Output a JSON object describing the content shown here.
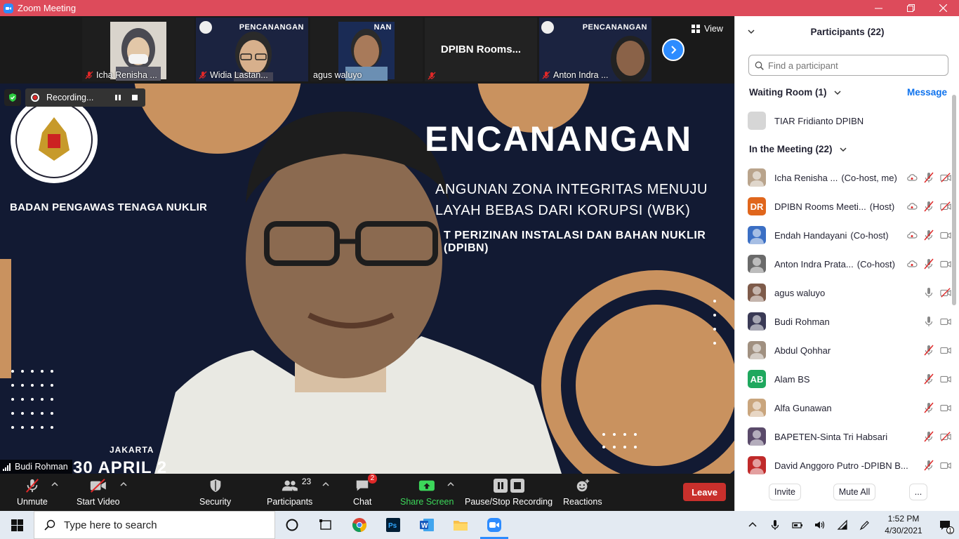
{
  "window": {
    "title": "Zoom Meeting"
  },
  "thumbnails": [
    {
      "name": "Icha Renisha ...",
      "muted": true
    },
    {
      "name": "Widia Lastan...",
      "muted": true,
      "slide_text": "PENCANANGAN"
    },
    {
      "name": "agus waluyo",
      "muted": false,
      "slide_text": "NAN"
    },
    {
      "name": "DPIBN Rooms...",
      "muted": true,
      "text_only": true
    },
    {
      "name": "Anton Indra ...",
      "muted": true,
      "slide_text": "PENCANANGAN"
    }
  ],
  "view_label": "View",
  "recording": {
    "label": "Recording..."
  },
  "main_video": {
    "speaker": "Budi Rohman",
    "slide": {
      "org": "BADAN PENGAWAS TENAGA NUKLIR",
      "title": "ENCANANGAN",
      "line1": "ANGUNAN ZONA INTEGRITAS MENUJU",
      "line2": "LAYAH BEBAS DARI KORUPSI (WBK)",
      "line3": "T PERIZINAN INSTALASI DAN BAHAN NUKLIR (DPIBN)",
      "city": "JAKARTA",
      "date": "30 APRIL 2"
    }
  },
  "toolbar": {
    "unmute": "Unmute",
    "start_video": "Start Video",
    "security": "Security",
    "participants": "Participants",
    "participants_count": "23",
    "chat": "Chat",
    "chat_badge": "2",
    "share_screen": "Share Screen",
    "recording": "Pause/Stop Recording",
    "reactions": "Reactions",
    "leave": "Leave"
  },
  "panel": {
    "title": "Participants (22)",
    "search_placeholder": "Find a participant",
    "waiting_room": "Waiting Room (1)",
    "message": "Message",
    "waiting": [
      {
        "name": "TIAR Fridianto DPIBN"
      }
    ],
    "in_meeting": "In the Meeting (22)",
    "participants": [
      {
        "name": "Icha Renisha ...",
        "role": "(Co-host, me)",
        "avatar": "photo",
        "color": "#b9a48c",
        "rec": true,
        "mic": "muted",
        "cam": "off"
      },
      {
        "name": "DPIBN Rooms Meeti...",
        "role": "(Host)",
        "avatar": "DR",
        "color": "#e0661c",
        "rec": true,
        "mic": "muted",
        "cam": "off"
      },
      {
        "name": "Endah Handayani",
        "role": "(Co-host)",
        "avatar": "photo",
        "color": "#3b6fc4",
        "rec": true,
        "mic": "muted",
        "cam": "on"
      },
      {
        "name": "Anton Indra Prata...",
        "role": "(Co-host)",
        "avatar": "photo",
        "color": "#6a6a6a",
        "rec": true,
        "mic": "muted",
        "cam": "on"
      },
      {
        "name": "agus waluyo",
        "role": "",
        "avatar": "photo",
        "color": "#7e5b4a",
        "rec": false,
        "mic": "on",
        "cam": "off"
      },
      {
        "name": "Budi Rohman",
        "role": "",
        "avatar": "photo",
        "color": "#3a3a55",
        "rec": false,
        "mic": "on",
        "cam": "on"
      },
      {
        "name": "Abdul Qohhar",
        "role": "",
        "avatar": "photo",
        "color": "#a09080",
        "rec": false,
        "mic": "muted",
        "cam": "on"
      },
      {
        "name": "Alam BS",
        "role": "",
        "avatar": "AB",
        "color": "#1fa85e",
        "rec": false,
        "mic": "muted",
        "cam": "on"
      },
      {
        "name": "Alfa Gunawan",
        "role": "",
        "avatar": "photo",
        "color": "#c9a57d",
        "rec": false,
        "mic": "muted",
        "cam": "on"
      },
      {
        "name": "BAPETEN-Sinta Tri Habsari",
        "role": "",
        "avatar": "photo",
        "color": "#5a4a6a",
        "rec": false,
        "mic": "muted",
        "cam": "off"
      },
      {
        "name": "David Anggoro Putro -DPIBN B...",
        "role": "",
        "avatar": "photo",
        "color": "#c02a2a",
        "rec": false,
        "mic": "muted",
        "cam": "on"
      }
    ],
    "invite": "Invite",
    "mute_all": "Mute All",
    "more": "..."
  },
  "taskbar": {
    "search_placeholder": "Type here to search",
    "time": "1:52 PM",
    "date": "4/30/2021",
    "notif_count": "1"
  },
  "colors": {
    "accent": "#2d8cff",
    "titlebar": "#dd4b5b",
    "leave": "#c9302c",
    "share": "#3cd75a",
    "muted": "#e02828"
  }
}
